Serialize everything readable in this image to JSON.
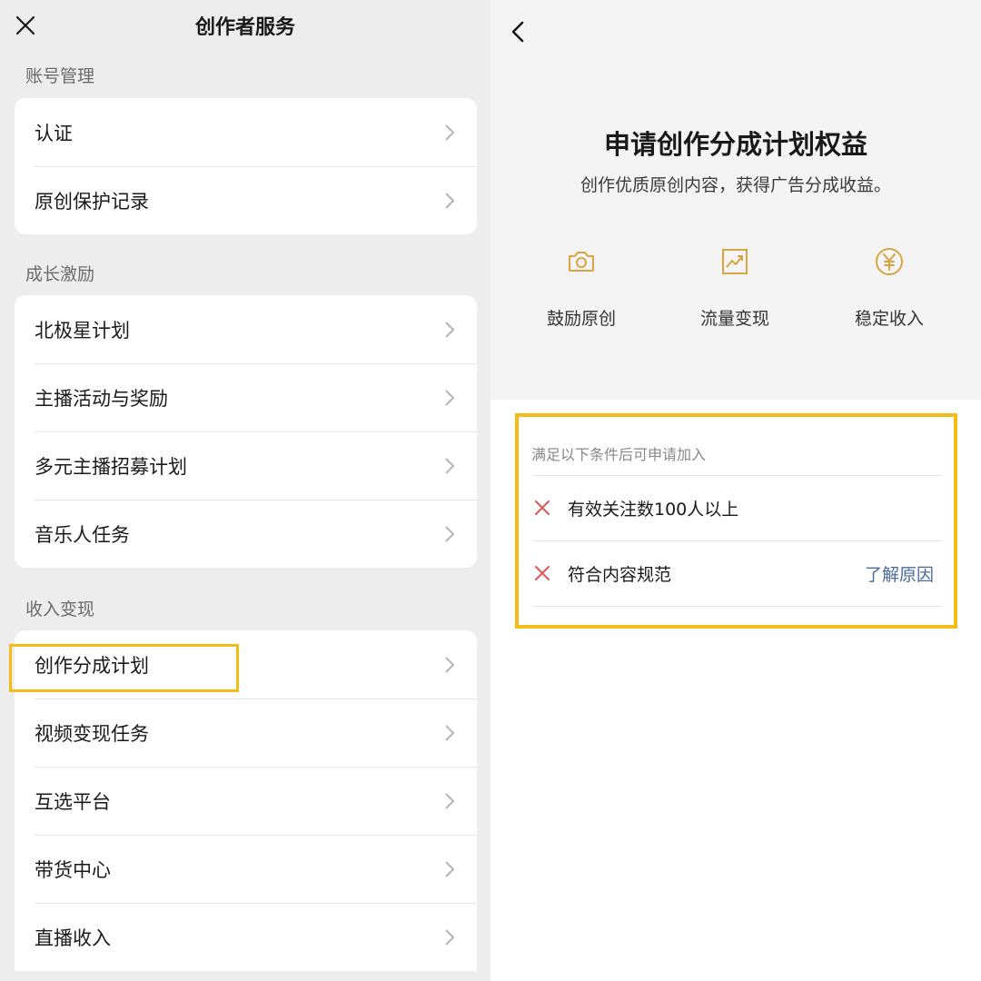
{
  "left": {
    "title": "创作者服务",
    "sections": [
      {
        "label": "账号管理",
        "items": [
          "认证",
          "原创保护记录"
        ]
      },
      {
        "label": "成长激励",
        "items": [
          "北极星计划",
          "主播活动与奖励",
          "多元主播招募计划",
          "音乐人任务"
        ]
      },
      {
        "label": "收入变现",
        "items": [
          "创作分成计划",
          "视频变现任务",
          "互选平台",
          "带货中心",
          "直播收入"
        ]
      }
    ]
  },
  "right": {
    "title": "申请创作分成计划权益",
    "subtitle": "创作优质原创内容，获得广告分成收益。",
    "features": [
      {
        "icon": "camera-icon",
        "label": "鼓励原创"
      },
      {
        "icon": "trend-chart-icon",
        "label": "流量变现"
      },
      {
        "icon": "yen-coin-icon",
        "label": "稳定收入"
      }
    ],
    "conditions": {
      "header": "满足以下条件后可申请加入",
      "items": [
        {
          "text": "有效关注数100人以上",
          "status": "not-met"
        },
        {
          "text": "符合内容规范",
          "status": "not-met",
          "link": "了解原因"
        }
      ]
    }
  },
  "colors": {
    "highlight": "#f5bc17",
    "icon_accent": "#d9a441",
    "fail_x": "#e05555",
    "link": "#4a6a9b"
  }
}
